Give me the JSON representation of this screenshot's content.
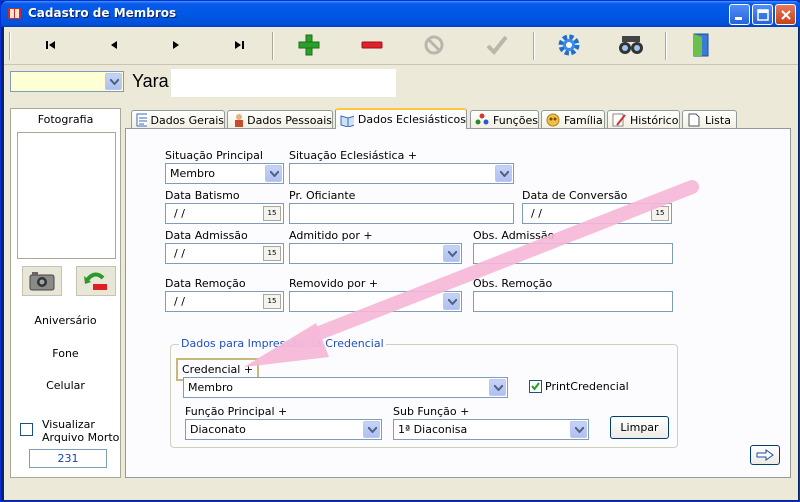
{
  "window": {
    "title": "Cadastro de Membros"
  },
  "toolbar": {
    "buttons": [
      "first-record",
      "previous-record",
      "next-record",
      "last-record",
      "add",
      "remove",
      "cancel",
      "confirm",
      "settings",
      "search",
      "exit"
    ]
  },
  "header": {
    "member_name": "Yara",
    "selector_value": ""
  },
  "left_panel": {
    "photo_label": "Fotografia",
    "birthday_label": "Aniversário",
    "phone_label": "Fone",
    "mobile_label": "Celular",
    "archive_checkbox_label_line1": "Visualizar",
    "archive_checkbox_label_line2": "Arquivo Morto",
    "record_count": "231"
  },
  "tabs": [
    {
      "label": "Dados Gerais"
    },
    {
      "label": "Dados Pessoais"
    },
    {
      "label": "Dados Eclesiásticos"
    },
    {
      "label": "Funções"
    },
    {
      "label": "Família"
    },
    {
      "label": "Histórico"
    },
    {
      "label": "Lista"
    }
  ],
  "form": {
    "situacao_principal_label": "Situação Principal",
    "situacao_principal_value": "Membro",
    "situacao_eclesiastica_label": "Situação Eclesiástica +",
    "situacao_eclesiastica_value": "",
    "data_batismo_label": "Data Batismo",
    "data_batismo_value": "/ /",
    "pr_oficiante_label": "Pr. Oficiante",
    "data_conversao_label": "Data de Conversão",
    "data_conversao_value": "/ /",
    "data_admissao_label": "Data Admissão",
    "data_admissao_value": "/ /",
    "admitido_por_label": "Admitido por +",
    "obs_admissao_label": "Obs. Admissão",
    "data_remocao_label": "Data Remoção",
    "data_remocao_value": "/ /",
    "removido_por_label": "Removido por +",
    "obs_remocao_label": "Obs. Remoção",
    "calendar_glyph": "15"
  },
  "print_group": {
    "title": "Dados para Impressão da Credencial",
    "credencial_label": "Credencial +",
    "credencial_value": "Membro",
    "print_checkbox_label": "PrintCredencial",
    "print_checked": true,
    "funcao_principal_label": "Função Principal +",
    "funcao_principal_value": "Diaconato",
    "sub_funcao_label": "Sub Função +",
    "sub_funcao_value": "1ª Diaconisa",
    "clear_button": "Limpar"
  },
  "colors": {
    "accent_pink": "#f6b8d8",
    "highlight_box": "#c8b97a",
    "group_title": "#1f4fbf"
  }
}
